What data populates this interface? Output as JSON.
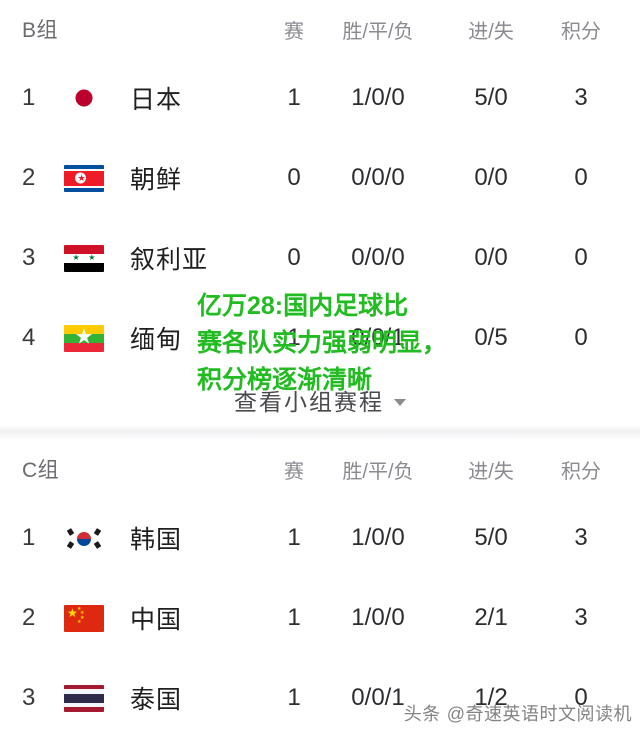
{
  "columns": {
    "played": "赛",
    "wdl": "胜/平/负",
    "goals": "进/失",
    "points": "积分"
  },
  "groups": [
    {
      "name": "B组",
      "rows": [
        {
          "rank": "1",
          "flag": "jp",
          "team": "日本",
          "played": "1",
          "wdl": "1/0/0",
          "goals": "5/0",
          "points": "3"
        },
        {
          "rank": "2",
          "flag": "kp",
          "team": "朝鲜",
          "played": "0",
          "wdl": "0/0/0",
          "goals": "0/0",
          "points": "0"
        },
        {
          "rank": "3",
          "flag": "sy",
          "team": "叙利亚",
          "played": "0",
          "wdl": "0/0/0",
          "goals": "0/0",
          "points": "0"
        },
        {
          "rank": "4",
          "flag": "mm",
          "team": "缅甸",
          "played": "1",
          "wdl": "0/0/1",
          "goals": "0/5",
          "points": "0"
        }
      ],
      "schedule_label": "查看小组赛程"
    },
    {
      "name": "C组",
      "rows": [
        {
          "rank": "1",
          "flag": "kr",
          "team": "韩国",
          "played": "1",
          "wdl": "1/0/0",
          "goals": "5/0",
          "points": "3"
        },
        {
          "rank": "2",
          "flag": "cn",
          "team": "中国",
          "played": "1",
          "wdl": "1/0/0",
          "goals": "2/1",
          "points": "3"
        },
        {
          "rank": "3",
          "flag": "th",
          "team": "泰国",
          "played": "1",
          "wdl": "0/0/1",
          "goals": "1/2",
          "points": "0"
        }
      ]
    }
  ],
  "watermark": {
    "headline_lines": [
      "亿万28:国内足球比",
      "赛各队实力强弱明显，",
      "积分榜逐渐清晰"
    ],
    "headline_color": "#22bb22",
    "footer_source": "头条",
    "footer_handle": "@奇速英语时文阅读机"
  }
}
